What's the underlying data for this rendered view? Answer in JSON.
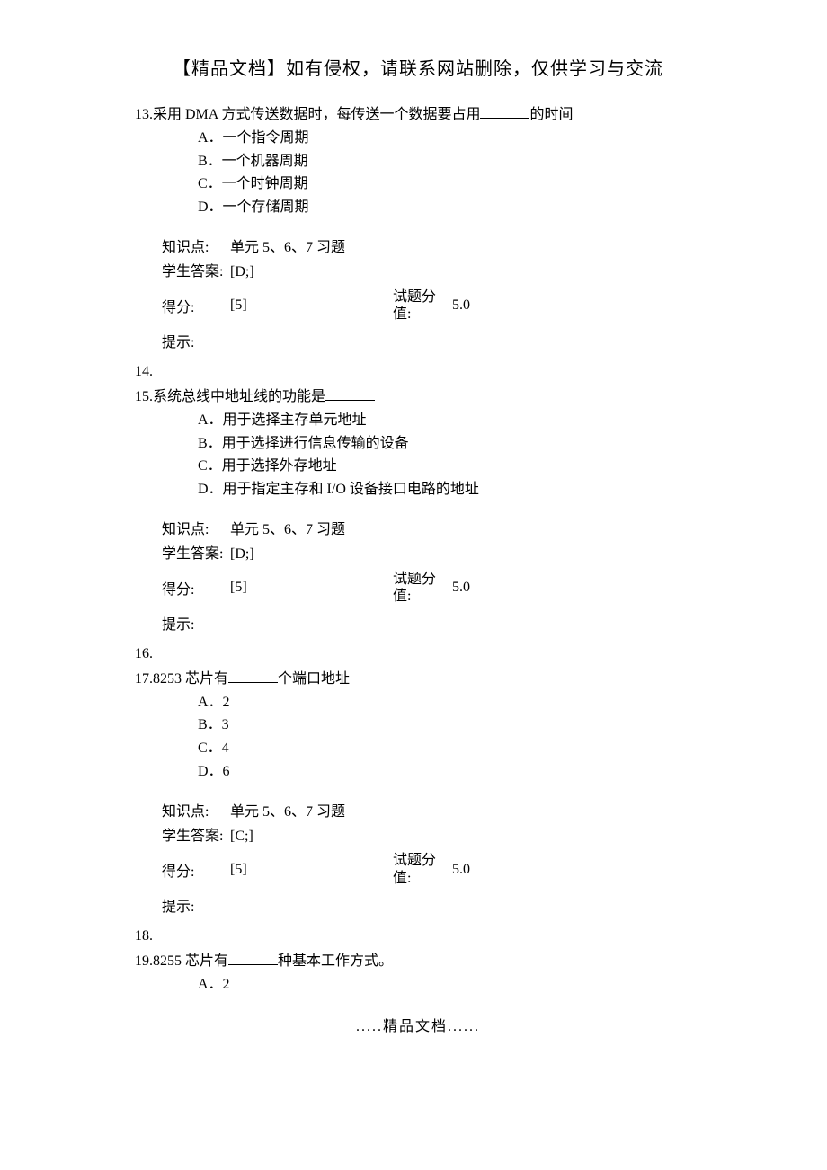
{
  "header": "【精品文档】如有侵权，请联系网站删除，仅供学习与交流",
  "footer": ".....精品文档......",
  "questions": [
    {
      "number": "13.",
      "stem_before": "采用 DMA 方式传送数据时，每传送一个数据要占用",
      "stem_after": "的时间",
      "options": [
        "A．一个指令周期",
        "B．一个机器周期",
        "C．一个时钟周期",
        "D．一个存储周期"
      ],
      "meta": {
        "knowledge_label": "知识点:",
        "knowledge_value": "单元 5、6、7 习题",
        "answer_label": "学生答案:",
        "answer_value": "[D;]",
        "score_label": "得分:",
        "score_value": "[5]",
        "weight_label": "试题分值:",
        "weight_value": "5.0",
        "hint_label": "提示:",
        "hint_value": ""
      }
    },
    {
      "spacer_number": "14.",
      "number": "15.",
      "stem_before": "系统总线中地址线的功能是",
      "stem_after": "",
      "options": [
        "A．用于选择主存单元地址",
        "B．用于选择进行信息传输的设备",
        "C．用于选择外存地址",
        "D．用于指定主存和 I/O 设备接口电路的地址"
      ],
      "meta": {
        "knowledge_label": "知识点:",
        "knowledge_value": "单元 5、6、7 习题",
        "answer_label": "学生答案:",
        "answer_value": "[D;]",
        "score_label": "得分:",
        "score_value": "[5]",
        "weight_label": "试题分值:",
        "weight_value": "5.0",
        "hint_label": "提示:",
        "hint_value": ""
      }
    },
    {
      "spacer_number": "16.",
      "number": "17.",
      "stem_before": "8253 芯片有",
      "stem_after": "个端口地址",
      "options": [
        "A．2",
        "B．3",
        "C．4",
        "D．6"
      ],
      "meta": {
        "knowledge_label": "知识点:",
        "knowledge_value": "单元 5、6、7 习题",
        "answer_label": "学生答案:",
        "answer_value": "[C;]",
        "score_label": "得分:",
        "score_value": "[5]",
        "weight_label": "试题分值:",
        "weight_value": "5.0",
        "hint_label": "提示:",
        "hint_value": ""
      }
    },
    {
      "spacer_number": "18.",
      "number": "19.",
      "stem_before": "8255 芯片有",
      "stem_after": "种基本工作方式。",
      "options": [
        "A．2"
      ],
      "meta": null
    }
  ]
}
